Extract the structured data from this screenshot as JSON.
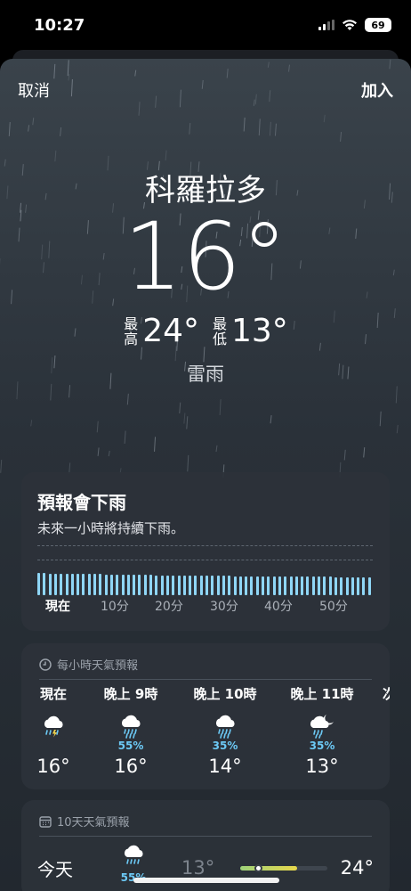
{
  "status_bar": {
    "time": "10:27",
    "battery": "69",
    "signal_icon": "cellular-signal-icon",
    "wifi_icon": "wifi-icon"
  },
  "nav": {
    "cancel_label": "取消",
    "add_label": "加入"
  },
  "current": {
    "city": "科羅拉多",
    "temperature": "16°",
    "high_label": [
      "最",
      "高"
    ],
    "high_value": "24°",
    "low_label": [
      "最",
      "低"
    ],
    "low_value": "13°",
    "condition": "雷雨"
  },
  "precip_card": {
    "title": "預報會下雨",
    "subtitle": "未來一小時將持續下雨。",
    "ticks": [
      "現在",
      "10分",
      "20分",
      "30分",
      "40分",
      "50分"
    ],
    "intensity": [
      0.9,
      0.88,
      0.87,
      0.87,
      0.86,
      0.86,
      0.85,
      0.85,
      0.85,
      0.84,
      0.84,
      0.84,
      0.83,
      0.83,
      0.83,
      0.82,
      0.82,
      0.82,
      0.81,
      0.81,
      0.81,
      0.8,
      0.8,
      0.8,
      0.79,
      0.79,
      0.79,
      0.78,
      0.78,
      0.78,
      0.78,
      0.77,
      0.77,
      0.77,
      0.77,
      0.76,
      0.76,
      0.76,
      0.76,
      0.76,
      0.75,
      0.75,
      0.75,
      0.75,
      0.75,
      0.75,
      0.74,
      0.74,
      0.74,
      0.74,
      0.74,
      0.74,
      0.74,
      0.73,
      0.73,
      0.73,
      0.73,
      0.73,
      0.73,
      0.73
    ],
    "bar_color": "#8fd6f6"
  },
  "hourly": {
    "header": "每小時天氣預報",
    "header_icon": "clock-icon",
    "items": [
      {
        "label": "現在",
        "icon": "thunderstorm-icon",
        "pop": "",
        "temp": "16°"
      },
      {
        "label": "晚上 9時",
        "icon": "rain-cloud-icon",
        "pop": "55%",
        "temp": "16°"
      },
      {
        "label": "晚上 10時",
        "icon": "rain-cloud-icon",
        "pop": "35%",
        "temp": "14°"
      },
      {
        "label": "晚上 11時",
        "icon": "night-rain-icon",
        "pop": "35%",
        "temp": "13°"
      }
    ],
    "edge_label": "次"
  },
  "daily": {
    "header": "10天天氣預報",
    "header_icon": "calendar-icon",
    "rows": [
      {
        "day": "今天",
        "icon": "rain-cloud-icon",
        "pop": "55%",
        "low": "13°",
        "high": "24°",
        "range_start": 0.0,
        "range_end": 0.65,
        "current_pos": 0.2
      }
    ]
  },
  "colors": {
    "accent_precip": "#6cc9f5",
    "background_top": "#3a434b",
    "background_bottom": "#22282f"
  }
}
